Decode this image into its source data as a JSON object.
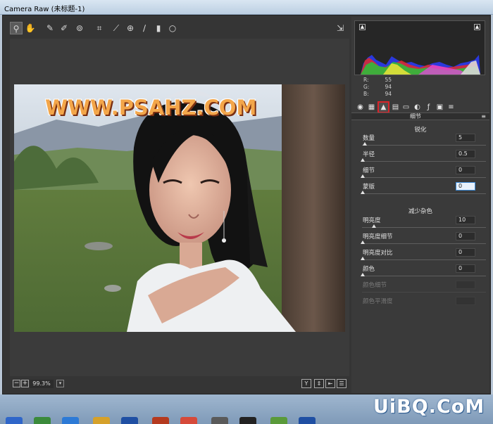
{
  "window": {
    "title": "Camera Raw (未标题-1)"
  },
  "toolbar": {
    "tools": [
      "zoom-icon",
      "hand-icon",
      "white-balance-icon",
      "color-sampler-icon",
      "target-adjust-icon",
      "crop-icon",
      "straighten-icon",
      "red-eye-icon",
      "brush-icon",
      "graduated-filter-icon",
      "radial-filter-icon"
    ]
  },
  "preview": {
    "watermark": "WWW.PSAHZ.COM"
  },
  "bottombar": {
    "zoom_minus": "−",
    "zoom_plus": "+",
    "zoom": "99.3%",
    "btn_y": "Y"
  },
  "histogram": {
    "rgb": [
      {
        "label": "R:",
        "value": "55"
      },
      {
        "label": "G:",
        "value": "94"
      },
      {
        "label": "B:",
        "value": "94"
      }
    ]
  },
  "tabs": [
    "basic-icon",
    "tone-curve-icon",
    "detail-icon",
    "hsl-icon",
    "split-toning-icon",
    "lens-icon",
    "effects-icon",
    "camera-calibration-icon",
    "presets-icon"
  ],
  "panel": {
    "title": "细节",
    "sharpen": {
      "heading": "锐化",
      "rows": [
        {
          "label": "数量",
          "value": "5"
        },
        {
          "label": "半径",
          "value": "0.5"
        },
        {
          "label": "细节",
          "value": "0"
        },
        {
          "label": "蒙版",
          "value": "0"
        }
      ]
    },
    "noise": {
      "heading": "减少杂色",
      "rows": [
        {
          "label": "明亮度",
          "value": "10"
        },
        {
          "label": "明亮度细节",
          "value": "0"
        },
        {
          "label": "明亮度对比",
          "value": "0"
        },
        {
          "label": "颜色",
          "value": "0"
        },
        {
          "label": "颜色细节",
          "value": ""
        },
        {
          "label": "颜色平滑度",
          "value": ""
        }
      ]
    }
  },
  "taskbar": {
    "site_mark": "UiBQ.CoM"
  }
}
